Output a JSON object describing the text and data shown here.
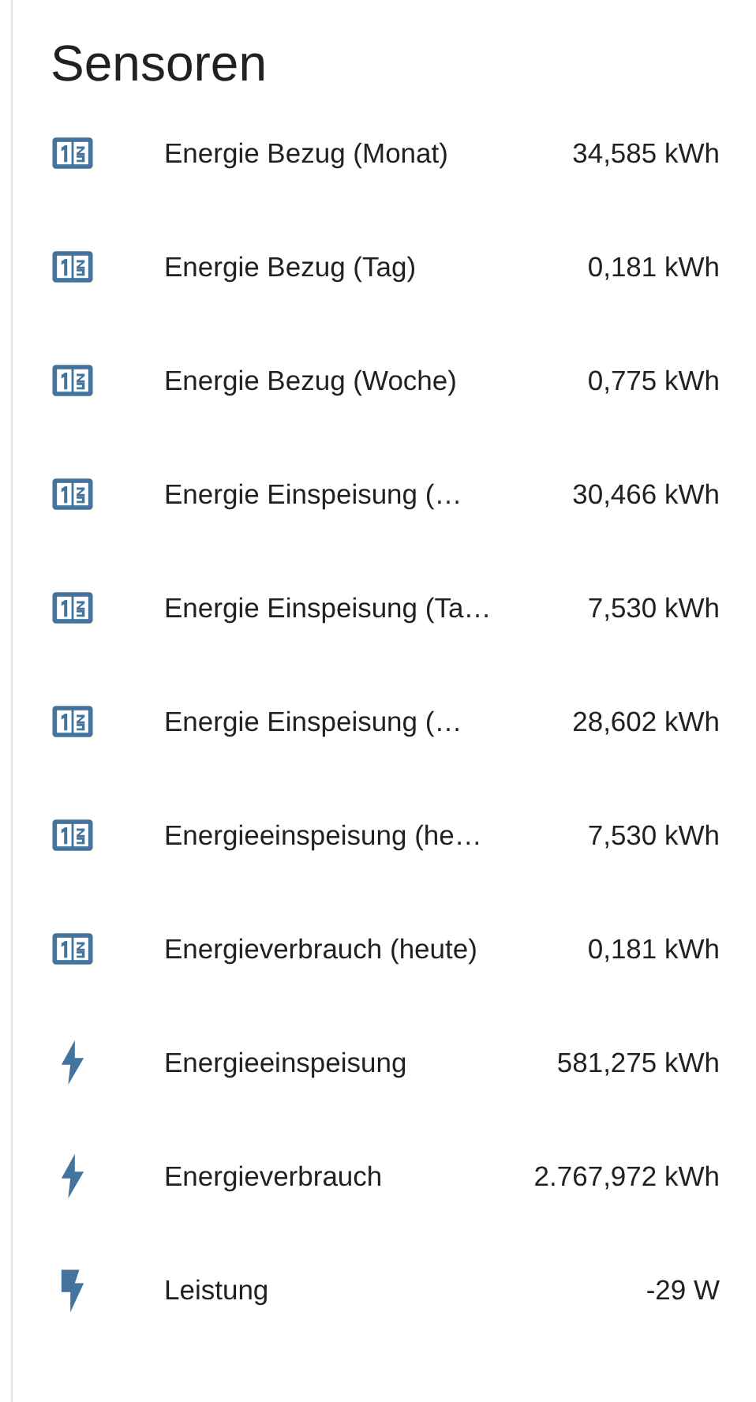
{
  "card": {
    "title": "Sensoren",
    "rows": [
      {
        "kind": "counter",
        "name": "Energie Bezug (Monat)",
        "value": "34,585 kWh"
      },
      {
        "kind": "counter",
        "name": "Energie Bezug (Tag)",
        "value": "0,181 kWh"
      },
      {
        "kind": "counter",
        "name": "Energie Bezug (Woche)",
        "value": "0,775 kWh"
      },
      {
        "kind": "counter",
        "name": "Energie Einspeisung (…",
        "value": "30,466 kWh"
      },
      {
        "kind": "counter",
        "name": "Energie Einspeisung (Ta…",
        "value": "7,530 kWh"
      },
      {
        "kind": "counter",
        "name": "Energie Einspeisung (…",
        "value": "28,602 kWh"
      },
      {
        "kind": "counter",
        "name": "Energieeinspeisung (he…",
        "value": "7,530 kWh"
      },
      {
        "kind": "counter",
        "name": "Energieverbrauch (heute)",
        "value": "0,181 kWh"
      },
      {
        "kind": "flash",
        "name": "Energieeinspeisung",
        "value": "581,275 kWh"
      },
      {
        "kind": "flash",
        "name": "Energieverbrauch",
        "value": "2.767,972 kWh"
      },
      {
        "kind": "flash-alt",
        "name": "Leistung",
        "value": "-29 W"
      }
    ]
  }
}
